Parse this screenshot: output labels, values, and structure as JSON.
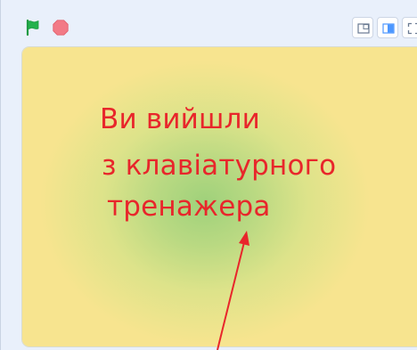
{
  "toolbar": {
    "flag_icon": "green-flag-icon",
    "stop_icon": "stop-sign-icon",
    "layout_buttons": [
      "small-stage-icon",
      "large-stage-icon",
      "fullscreen-icon"
    ]
  },
  "stage": {
    "message_lines": [
      "Ви вийшли",
      "з клавіатурного",
      "тренажера"
    ],
    "text_color": "#e8262b"
  },
  "colors": {
    "flag": "#22b14c",
    "stop": "#f27a86",
    "accent": "#4c97ff"
  }
}
